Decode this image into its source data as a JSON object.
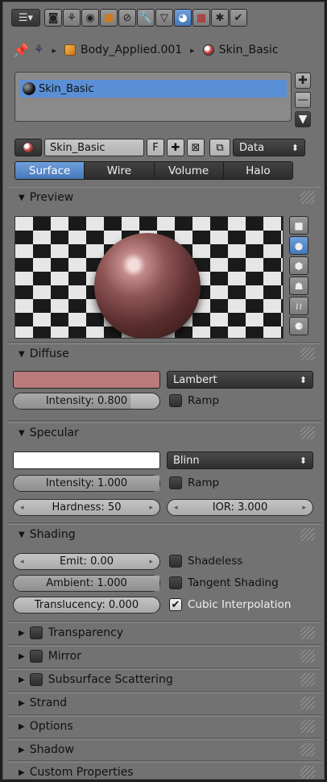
{
  "header": {
    "tabs": [
      {
        "icon": "editor-type-icon"
      },
      {
        "icon": "render-icon"
      },
      {
        "icon": "scene-icon"
      },
      {
        "icon": "world-icon"
      },
      {
        "icon": "object-icon"
      },
      {
        "icon": "constraints-icon"
      },
      {
        "icon": "modifiers-icon"
      },
      {
        "icon": "object-data-icon"
      },
      {
        "icon": "material-icon",
        "active": true
      },
      {
        "icon": "texture-icon"
      },
      {
        "icon": "particles-icon"
      },
      {
        "icon": "physics-icon"
      }
    ]
  },
  "breadcrumb": {
    "object": "Body_Applied.001",
    "material": "Skin_Basic"
  },
  "slots": {
    "items": [
      "Skin_Basic"
    ]
  },
  "datablock": {
    "name": "Skin_Basic",
    "fake_user": "F",
    "link": "Data"
  },
  "context_tabs": [
    "Surface",
    "Wire",
    "Volume",
    "Halo"
  ],
  "context_active": "Surface",
  "preview": {
    "title": "Preview",
    "active_shape": "sphere",
    "shapes": [
      "flat-icon",
      "sphere-icon",
      "cube-icon",
      "monkey-icon",
      "hair-icon",
      "world-sphere-icon"
    ]
  },
  "diffuse": {
    "title": "Diffuse",
    "color": "#bb7b7b",
    "shader": "Lambert",
    "intensity_label": "Intensity: 0.800",
    "intensity": 0.8,
    "ramp_label": "Ramp",
    "ramp": false
  },
  "specular": {
    "title": "Specular",
    "color": "#ffffff",
    "shader": "Blinn",
    "intensity_label": "Intensity: 1.000",
    "intensity": 1.0,
    "ramp_label": "Ramp",
    "ramp": false,
    "hardness_label": "Hardness: 50",
    "ior_label": "IOR: 3.000"
  },
  "shading": {
    "title": "Shading",
    "emit_label": "Emit: 0.00",
    "ambient_label": "Ambient: 1.000",
    "ambient": 1.0,
    "translucency_label": "Translucency: 0.000",
    "translucency": 0.0,
    "shadeless_label": "Shadeless",
    "shadeless": false,
    "tangent_label": "Tangent Shading",
    "tangent": false,
    "cubic_label": "Cubic Interpolation",
    "cubic": true
  },
  "collapsed_panels": [
    {
      "title": "Transparency",
      "checkbox": true
    },
    {
      "title": "Mirror",
      "checkbox": true
    },
    {
      "title": "Subsurface Scattering",
      "checkbox": true
    },
    {
      "title": "Strand",
      "checkbox": false
    },
    {
      "title": "Options",
      "checkbox": false
    },
    {
      "title": "Shadow",
      "checkbox": false
    },
    {
      "title": "Custom Properties",
      "checkbox": false
    }
  ],
  "colors": {
    "accent": "#5a8fd6",
    "panel": "#727272"
  }
}
